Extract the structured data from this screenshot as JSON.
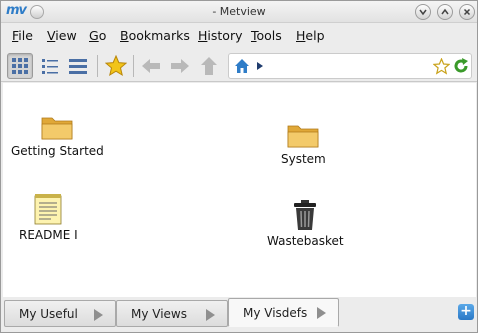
{
  "window": {
    "app_logo": "mv",
    "title": "- Metview",
    "controls": [
      "minimize",
      "maximize",
      "close"
    ]
  },
  "menubar": {
    "items": [
      {
        "label_u": "F",
        "label_rest": "ile"
      },
      {
        "label_u": "V",
        "label_rest": "iew"
      },
      {
        "label_u": "G",
        "label_rest": "o"
      },
      {
        "label_u": "B",
        "label_rest": "ookmarks"
      },
      {
        "label_u": "H",
        "label_rest": "istory"
      },
      {
        "label_u": "T",
        "label_rest": "ools"
      },
      {
        "label_u": "H",
        "label_rest": "elp"
      }
    ]
  },
  "toolbar": {
    "view_modes": [
      "icon-view",
      "detailed-view",
      "list-view"
    ],
    "active_view_mode": "icon-view",
    "bookmark_icon": "star-icon",
    "nav": [
      "back",
      "forward",
      "up"
    ],
    "address_icons": [
      "home-icon",
      "path-arrow-icon"
    ],
    "right_icons": [
      "bookmark-star-icon",
      "reload-icon"
    ]
  },
  "folder": {
    "items": [
      {
        "label": "Getting Started",
        "icon": "folder-icon"
      },
      {
        "label": "System",
        "icon": "folder-icon"
      },
      {
        "label": "README I",
        "icon": "notepad-icon"
      },
      {
        "label": "Wastebasket",
        "icon": "trash-icon"
      }
    ]
  },
  "tabs": {
    "items": [
      {
        "label": "My Useful"
      },
      {
        "label": "My Views"
      },
      {
        "label": "My Visdefs"
      }
    ],
    "active": "My Visdefs",
    "add_icon": "+"
  },
  "colors": {
    "accent": "#2f7dc8",
    "folder": "#e8b84a",
    "star": "#f2c419",
    "reload": "#3a9a2a"
  }
}
